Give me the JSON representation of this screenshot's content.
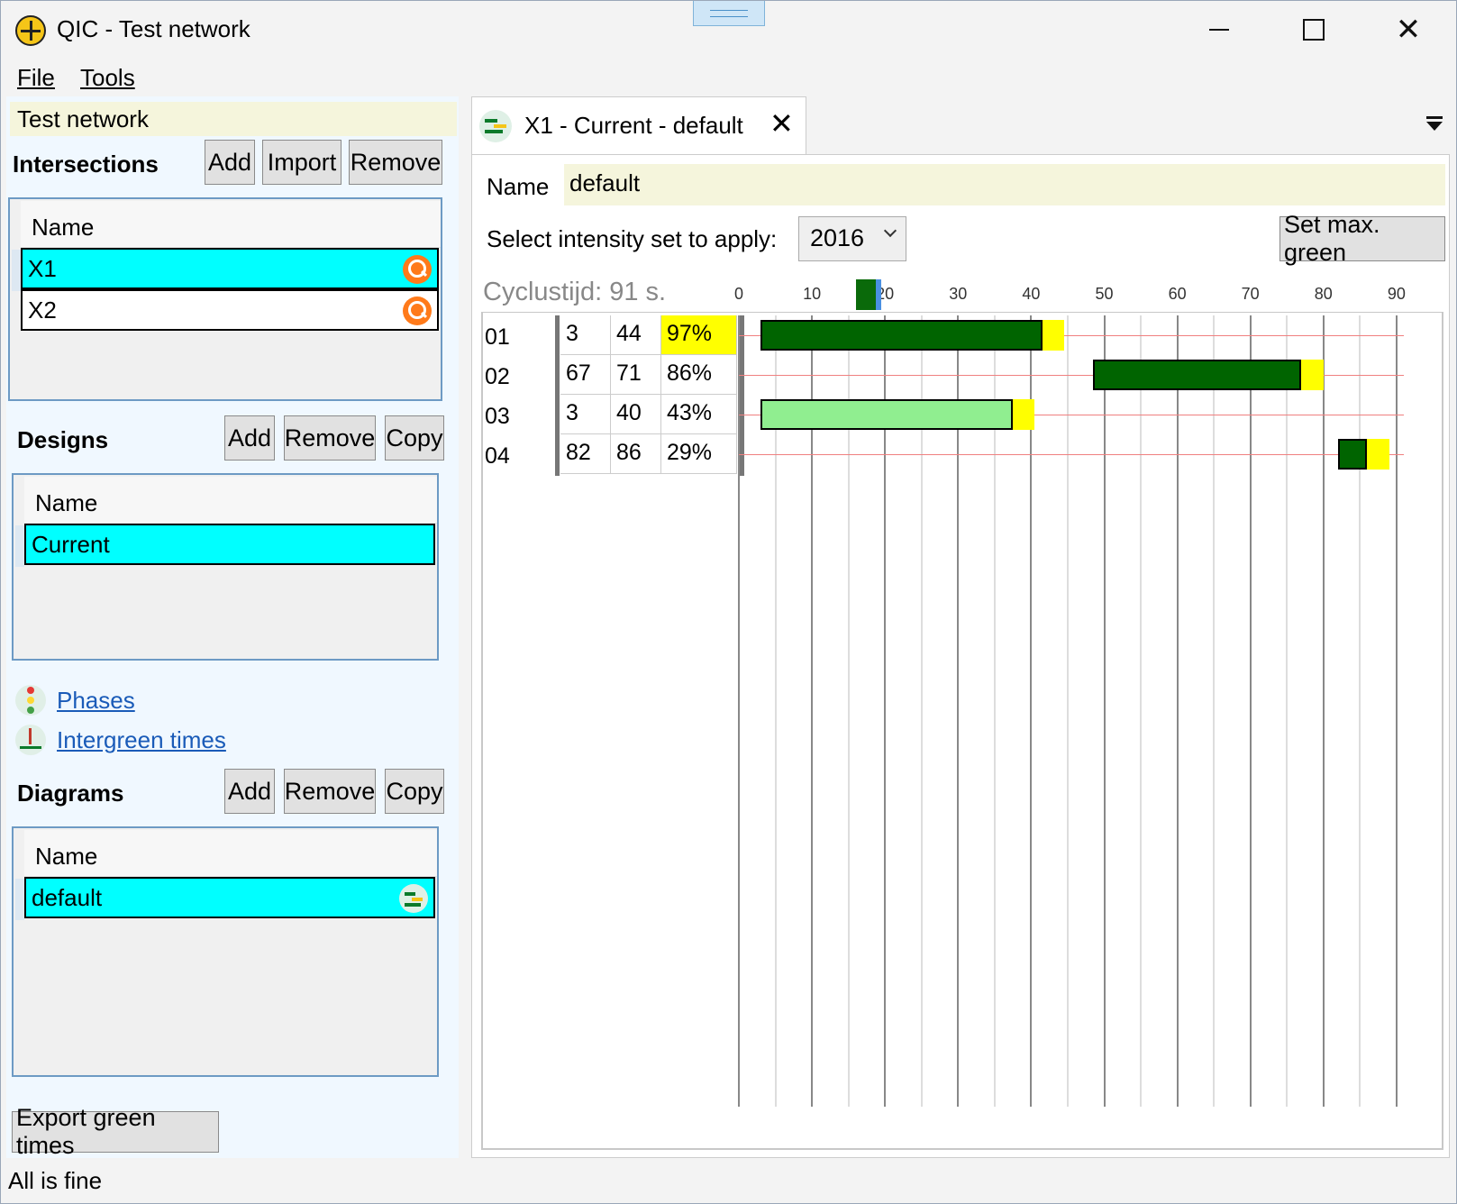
{
  "window": {
    "title": "QIC - Test network"
  },
  "menu": {
    "file": "File",
    "tools": "Tools"
  },
  "network": {
    "name": "Test network"
  },
  "intersections": {
    "title": "Intersections",
    "buttons": {
      "add": "Add",
      "import": "Import",
      "remove": "Remove"
    },
    "header": "Name",
    "rows": [
      {
        "name": "X1",
        "selected": true
      },
      {
        "name": "X2",
        "selected": false
      }
    ]
  },
  "designs": {
    "title": "Designs",
    "buttons": {
      "add": "Add",
      "remove": "Remove",
      "copy": "Copy"
    },
    "header": "Name",
    "rows": [
      {
        "name": "Current",
        "selected": true
      }
    ]
  },
  "links": {
    "phases": "Phases",
    "intergreen": "Intergreen times"
  },
  "diagrams": {
    "title": "Diagrams",
    "buttons": {
      "add": "Add",
      "remove": "Remove",
      "copy": "Copy"
    },
    "header": "Name",
    "rows": [
      {
        "name": "default",
        "selected": true
      }
    ]
  },
  "export_button": "Export green times",
  "tab": {
    "label": "X1 - Current - default"
  },
  "editor": {
    "name_label": "Name",
    "name_value": "default",
    "intensity_label": "Select intensity set to apply:",
    "intensity_value": "2016",
    "set_max_green": "Set max. green"
  },
  "status": "All is fine",
  "chart_data": {
    "type": "gantt",
    "title": "Cyclustijd: 91 s.",
    "cycle_time": 91,
    "xlim": [
      0,
      91
    ],
    "x_ticks": [
      0,
      10,
      20,
      30,
      40,
      50,
      60,
      70,
      80,
      90
    ],
    "slider_value": 16,
    "colors": {
      "green": "#006400",
      "light_green": "#90ee90",
      "yellow": "#ffff00",
      "highlight": "#ffff00",
      "ref_line": "#f08080"
    },
    "phases": [
      {
        "id": "01",
        "start": 3,
        "end": 44,
        "saturation": "97%",
        "highlight": true,
        "color": "green",
        "yellow": 3
      },
      {
        "id": "02",
        "start": 67,
        "end": 71,
        "saturation": "86%",
        "highlight": false,
        "color": "green",
        "yellow": 3,
        "bar_start": 48.5,
        "bar_end": 80
      },
      {
        "id": "03",
        "start": 3,
        "end": 40,
        "saturation": "43%",
        "highlight": false,
        "color": "light_green",
        "yellow": 3
      },
      {
        "id": "04",
        "start": 82,
        "end": 86,
        "saturation": "29%",
        "highlight": false,
        "color": "green",
        "yellow": 3
      }
    ]
  }
}
